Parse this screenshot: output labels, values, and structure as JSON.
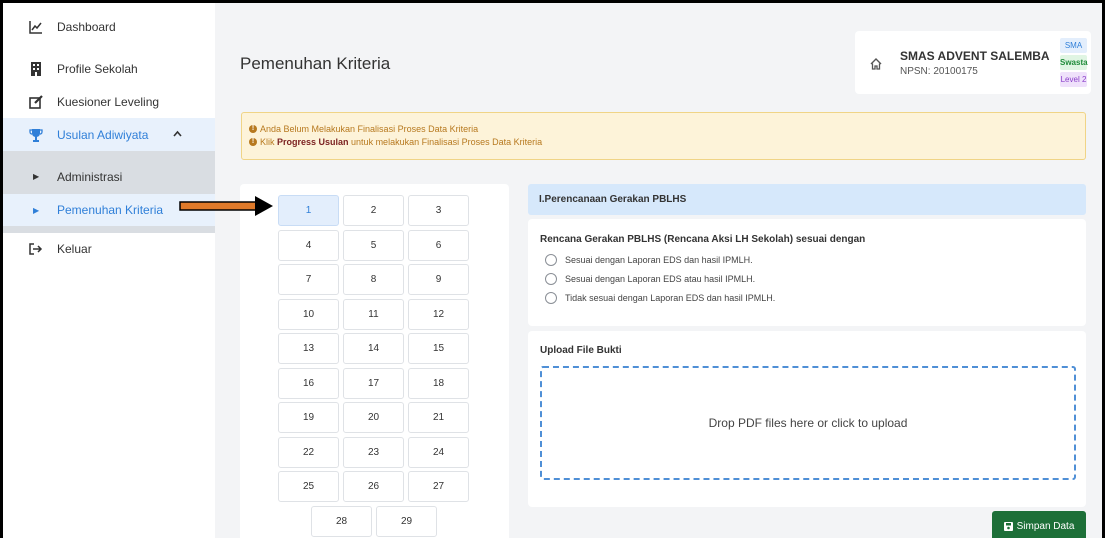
{
  "sidebar": {
    "items": [
      {
        "label": "Dashboard",
        "icon": "chart-line-icon"
      },
      {
        "label": "Profile Sekolah",
        "icon": "building-icon"
      },
      {
        "label": "Kuesioner Leveling",
        "icon": "edit-icon"
      },
      {
        "label": "Usulan Adiwiyata",
        "icon": "trophy-icon"
      }
    ],
    "sub_items": [
      {
        "label": "Administrasi"
      },
      {
        "label": "Pemenuhan Kriteria"
      }
    ],
    "logout": {
      "label": "Keluar",
      "icon": "sign-out-icon"
    }
  },
  "header": {
    "title": "Pemenuhan Kriteria",
    "school": {
      "name": "SMAS ADVENT SALEMBA",
      "npsn": "NPSN: 20100175",
      "badges": [
        "SMA",
        "Swasta",
        "Level 2"
      ]
    }
  },
  "alert": {
    "line1": "Anda Belum Melakukan Finalisasi Proses Data Kriteria",
    "line2_prefix": "Klik ",
    "line2_bold": "Progress Usulan",
    "line2_suffix": " untuk melakukan Finalisasi Proses Data Kriteria"
  },
  "criteria_numbers": [
    "1",
    "2",
    "3",
    "4",
    "5",
    "6",
    "7",
    "8",
    "9",
    "10",
    "11",
    "12",
    "13",
    "14",
    "15",
    "16",
    "17",
    "18",
    "19",
    "20",
    "21",
    "22",
    "23",
    "24",
    "25",
    "26",
    "27",
    "28",
    "29"
  ],
  "active_number": "1",
  "section": {
    "title": "I.Perencanaan Gerakan PBLHS",
    "question": "Rencana Gerakan PBLHS (Rencana Aksi LH Sekolah) sesuai dengan",
    "options": [
      "Sesuai dengan Laporan EDS dan hasil IPMLH.",
      "Sesuai dengan Laporan EDS atau hasil IPMLH.",
      "Tidak sesuai dengan Laporan EDS dan hasil IPMLH."
    ]
  },
  "upload": {
    "title": "Upload File Bukti",
    "drop_text": "Drop PDF files here or click to upload"
  },
  "save_button": "Simpan Data",
  "colors": {
    "accent": "#2f7fd8",
    "save": "#1d6f38",
    "arrow": "#e07a2a"
  }
}
